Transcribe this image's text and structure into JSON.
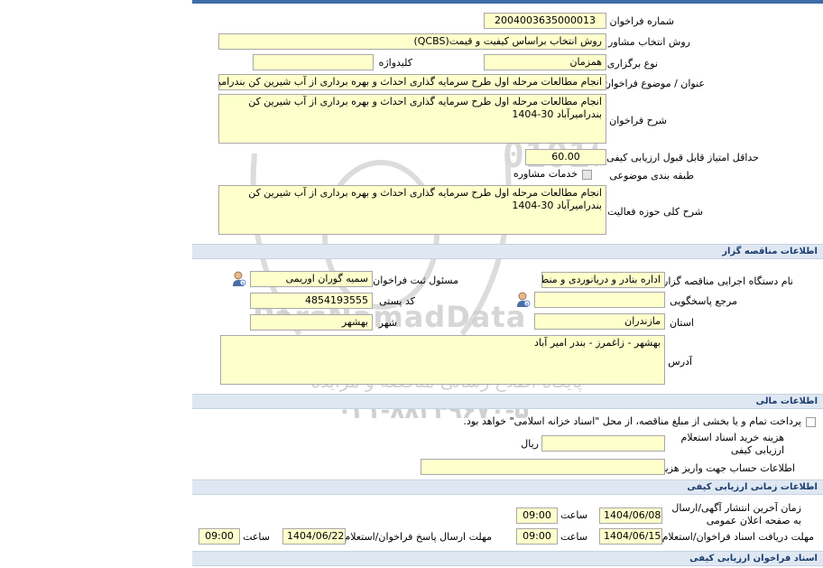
{
  "watermark": {
    "brand": "ParsNamadData",
    "line1": "مرکز فراوری اطلاعات پارس نماد داده ها",
    "line2": "پایگاه اطلاع رسانی مناقصه و مزایده",
    "phone": "۰۲۱-۸۸۳۴۹۶۷۰-۵",
    "digits": "010101"
  },
  "main": {
    "tender_number_label": "شماره فراخوان",
    "tender_number": "2004003635000013",
    "consultant_method_label": "روش انتخاب مشاور",
    "consultant_method": "روش انتخاب براساس کیفیت و قیمت(QCBS)",
    "holding_type_label": "نوع برگزاری",
    "holding_type": "همزمان",
    "keyword_label": "کلیدواژه",
    "keyword": "",
    "title_label": "عنوان / موضوع فراخوان",
    "title": "انجام مطالعات مرحله اول طرح سرمایه گذاری احداث و بهره برداری از آب شیرین کن بندرامیرآباد",
    "description_label": "شرح فراخوان",
    "description": "انجام مطالعات مرحله اول طرح سرمایه گذاری احداث و بهره برداری از آب شیرین کن بندرامیرآباد 30-1404",
    "min_score_label": "حداقل امتیاز قابل قبول ارزیابی کیفی",
    "min_score": "60.00",
    "subject_class_label": "طبقه بندی موضوعی",
    "subject_class_value": "خدمات مشاوره",
    "activity_label": "شرح کلی حوزه فعالیت",
    "activity": "انجام مطالعات مرحله اول طرح سرمایه گذاری احداث و بهره برداری از آب شیرین کن بندرامیرآباد 30-1404"
  },
  "organizer": {
    "section_title": "اطلاعات مناقصه گزار",
    "org_name_label": "نام دستگاه اجرایی مناقصه گزار",
    "org_name": "اداره بنادر و دریانوردی و منط",
    "registrar_label": "مسئول ثبت فراخوان",
    "registrar": "سمیه گوران اوریمی",
    "responder_label": "مرجع پاسخگویی",
    "responder": "",
    "postal_label": "کد پستی",
    "postal": "4854193555",
    "province_label": "استان",
    "province": "مازندران",
    "city_label": "شهر",
    "city": "بهشهر",
    "address_label": "آدرس",
    "address": "بهشهر - زاغمرز - بندر امیر آباد"
  },
  "finance": {
    "section_title": "اطلاعات مالی",
    "payment_note": "پرداخت تمام و یا بخشی از مبلغ مناقصه، از محل \"اسناد خزانه اسلامی\" خواهد بود.",
    "doc_cost_label": "هزینه خرید اسناد استعلام ارزیابی کیفی",
    "doc_cost": "",
    "currency": "ریال",
    "account_label": "اطلاعات حساب جهت واریز هزینه خرید",
    "account": ""
  },
  "timing": {
    "section_title": "اطلاعات زمانی ارزیابی کیفی",
    "last_publish_label": "زمان آخرین انتشار آگهی/ارسال به صفحه اعلان عمومی",
    "last_publish_date": "1404/06/08",
    "time_label": "ساعت",
    "last_publish_time": "09:00",
    "receive_deadline_label": "مهلت دریافت اسناد فراخوان/استعلام",
    "receive_deadline_date": "1404/06/15",
    "receive_deadline_time": "09:00",
    "send_deadline_label": "مهلت ارسال پاسخ فراخوان/استعلام",
    "send_deadline_date": "1404/06/22",
    "send_deadline_time": "09:00"
  },
  "quality_docs": {
    "section_title": "اسناد فراخوان ارزیابی کیفی"
  }
}
